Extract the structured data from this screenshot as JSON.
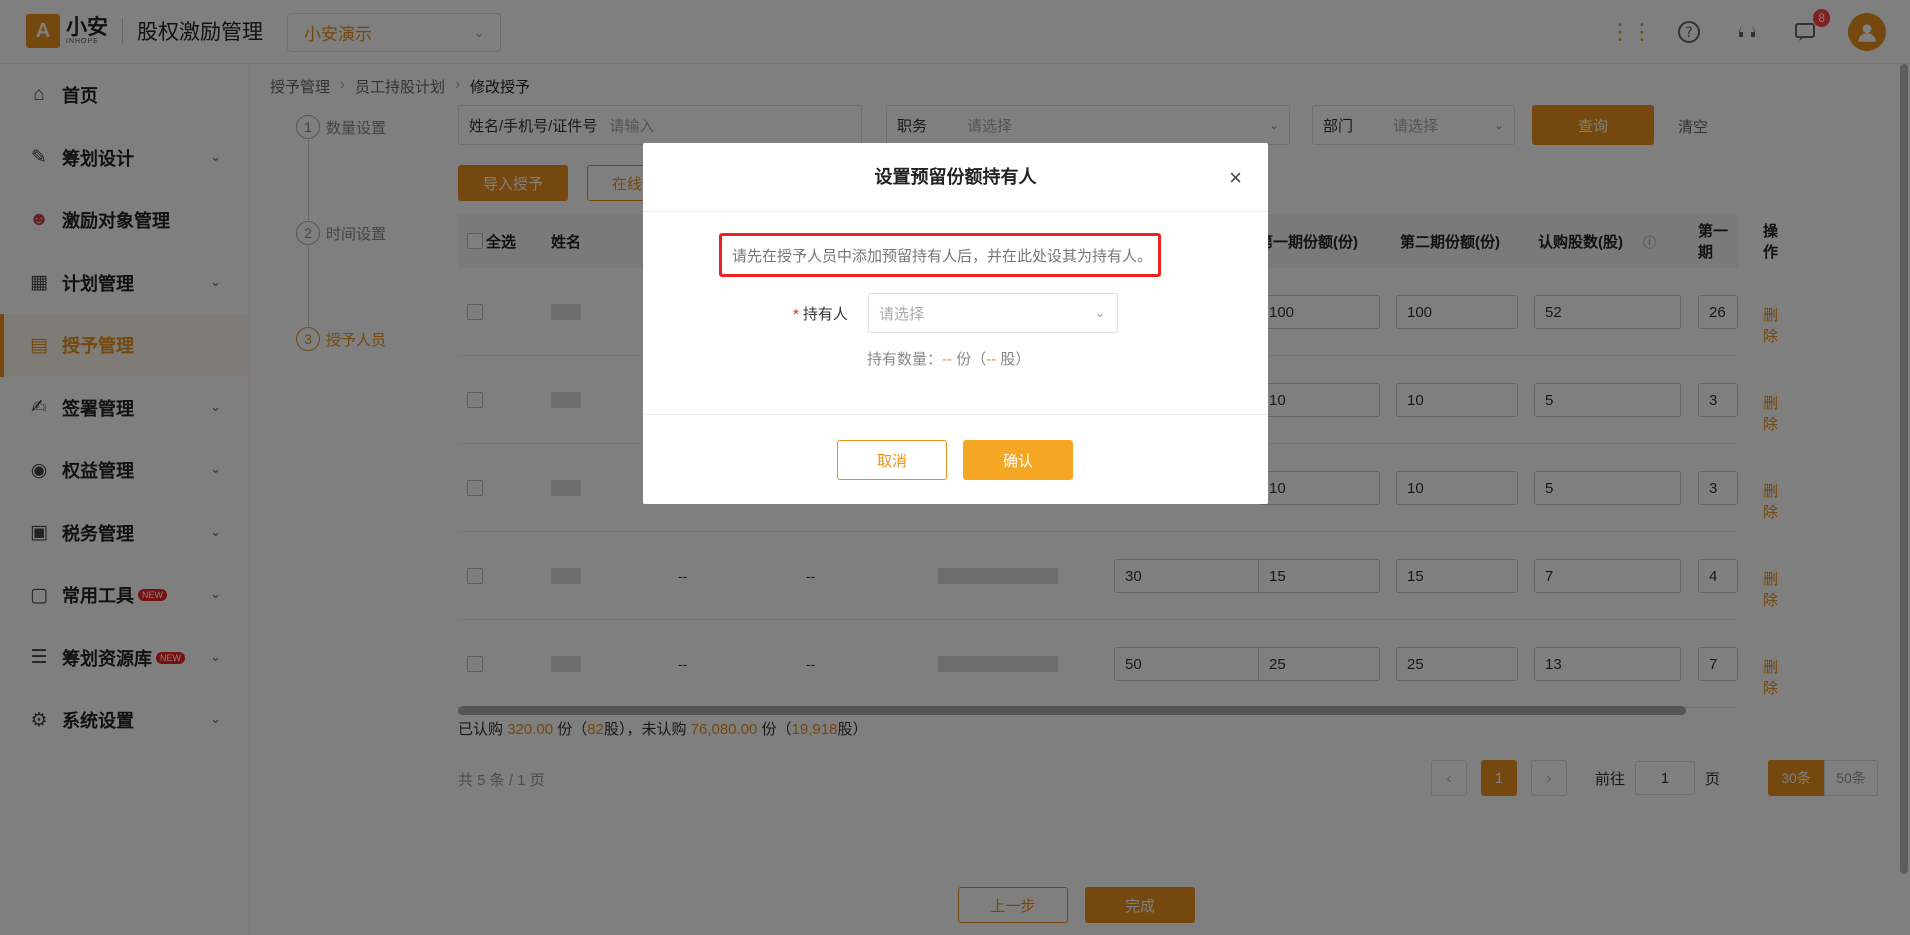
{
  "header": {
    "logo_mark": "A",
    "logo_cn": "小安",
    "logo_en": "INHOPE",
    "app_title": "股权激励管理",
    "company": "小安演示",
    "message_badge": "8"
  },
  "sidebar": {
    "items": [
      {
        "label": "首页",
        "icon": "home-icon"
      },
      {
        "label": "筹划设计",
        "icon": "edit-icon"
      },
      {
        "label": "激励对象管理",
        "icon": "users-icon"
      },
      {
        "label": "计划管理",
        "icon": "grid-icon"
      },
      {
        "label": "授予管理",
        "icon": "document-icon"
      },
      {
        "label": "签署管理",
        "icon": "sign-icon"
      },
      {
        "label": "权益管理",
        "icon": "equity-icon"
      },
      {
        "label": "税务管理",
        "icon": "tax-icon"
      },
      {
        "label": "常用工具",
        "icon": "toolbox-icon",
        "tag": "NEW"
      },
      {
        "label": "筹划资源库",
        "icon": "layers-icon",
        "tag": "NEW"
      },
      {
        "label": "系统设置",
        "icon": "settings-icon"
      }
    ]
  },
  "breadcrumb": [
    "授予管理",
    "员工持股计划",
    "修改授予"
  ],
  "steps": [
    {
      "num": "1",
      "label": "数量设置"
    },
    {
      "num": "2",
      "label": "时间设置"
    },
    {
      "num": "3",
      "label": "授予人员"
    }
  ],
  "filters": {
    "name_label": "姓名/手机号/证件号",
    "name_placeholder": "请输入",
    "position_label": "职务",
    "position_placeholder": "请选择",
    "dept_label": "部门",
    "dept_placeholder": "请选择",
    "query": "查询",
    "clear": "清空"
  },
  "actions": {
    "import": "导入授予",
    "online": "在线"
  },
  "table": {
    "headers": {
      "select_all": "全选",
      "name": "姓名",
      "phase1": "第一期份额(份)",
      "phase2": "第二期份额(份)",
      "subscribe": "认购股数(股)",
      "phase1_short": "第一期",
      "ops": "操作"
    },
    "rows": [
      {
        "c2": "",
        "c3": "",
        "total": "",
        "p1": "100",
        "p2": "100",
        "sub": "52",
        "p1s": "26",
        "op": "删除"
      },
      {
        "c2": "",
        "c3": "",
        "total": "",
        "p1": "10",
        "p2": "10",
        "sub": "5",
        "p1s": "3",
        "op": "删除"
      },
      {
        "c2": "",
        "c3": "",
        "total": "",
        "p1": "10",
        "p2": "10",
        "sub": "5",
        "p1s": "3",
        "op": "删除"
      },
      {
        "c2": "--",
        "c3": "--",
        "total": "30",
        "p1": "15",
        "p2": "15",
        "sub": "7",
        "p1s": "4",
        "op": "删除"
      },
      {
        "c2": "--",
        "c3": "--",
        "total": "50",
        "p1": "25",
        "p2": "25",
        "sub": "13",
        "p1s": "7",
        "op": "删除"
      }
    ]
  },
  "summary": {
    "t1": "已认购",
    "subscribed_units": "320.00",
    "t2": "份（",
    "subscribed_shares": "82",
    "t3": "股），未认购",
    "unsubscribed_units": "76,080.00",
    "t4": "份（",
    "unsubscribed_shares": "19,918",
    "t5": "股）"
  },
  "pagination": {
    "total": "共 5 条 / 1 页",
    "prev": "‹",
    "next": "›",
    "current": "1",
    "goto_label": "前往",
    "goto_value": "1",
    "page_unit": "页",
    "size30": "30条",
    "size50": "50条"
  },
  "footer": {
    "prev_step": "上一步",
    "finish": "完成"
  },
  "modal": {
    "title": "设置预留份额持有人",
    "close": "×",
    "hint": "请先在授予人员中添加预留持有人后，并在此处设其为持有人。",
    "holder_required": "*",
    "holder_label": "持有人",
    "holder_placeholder": "请选择",
    "qty_label": "持有数量：",
    "qty_units": "--",
    "qty_mid1": "份（",
    "qty_shares": "--",
    "qty_mid2": "股）",
    "cancel": "取消",
    "confirm": "确认"
  }
}
